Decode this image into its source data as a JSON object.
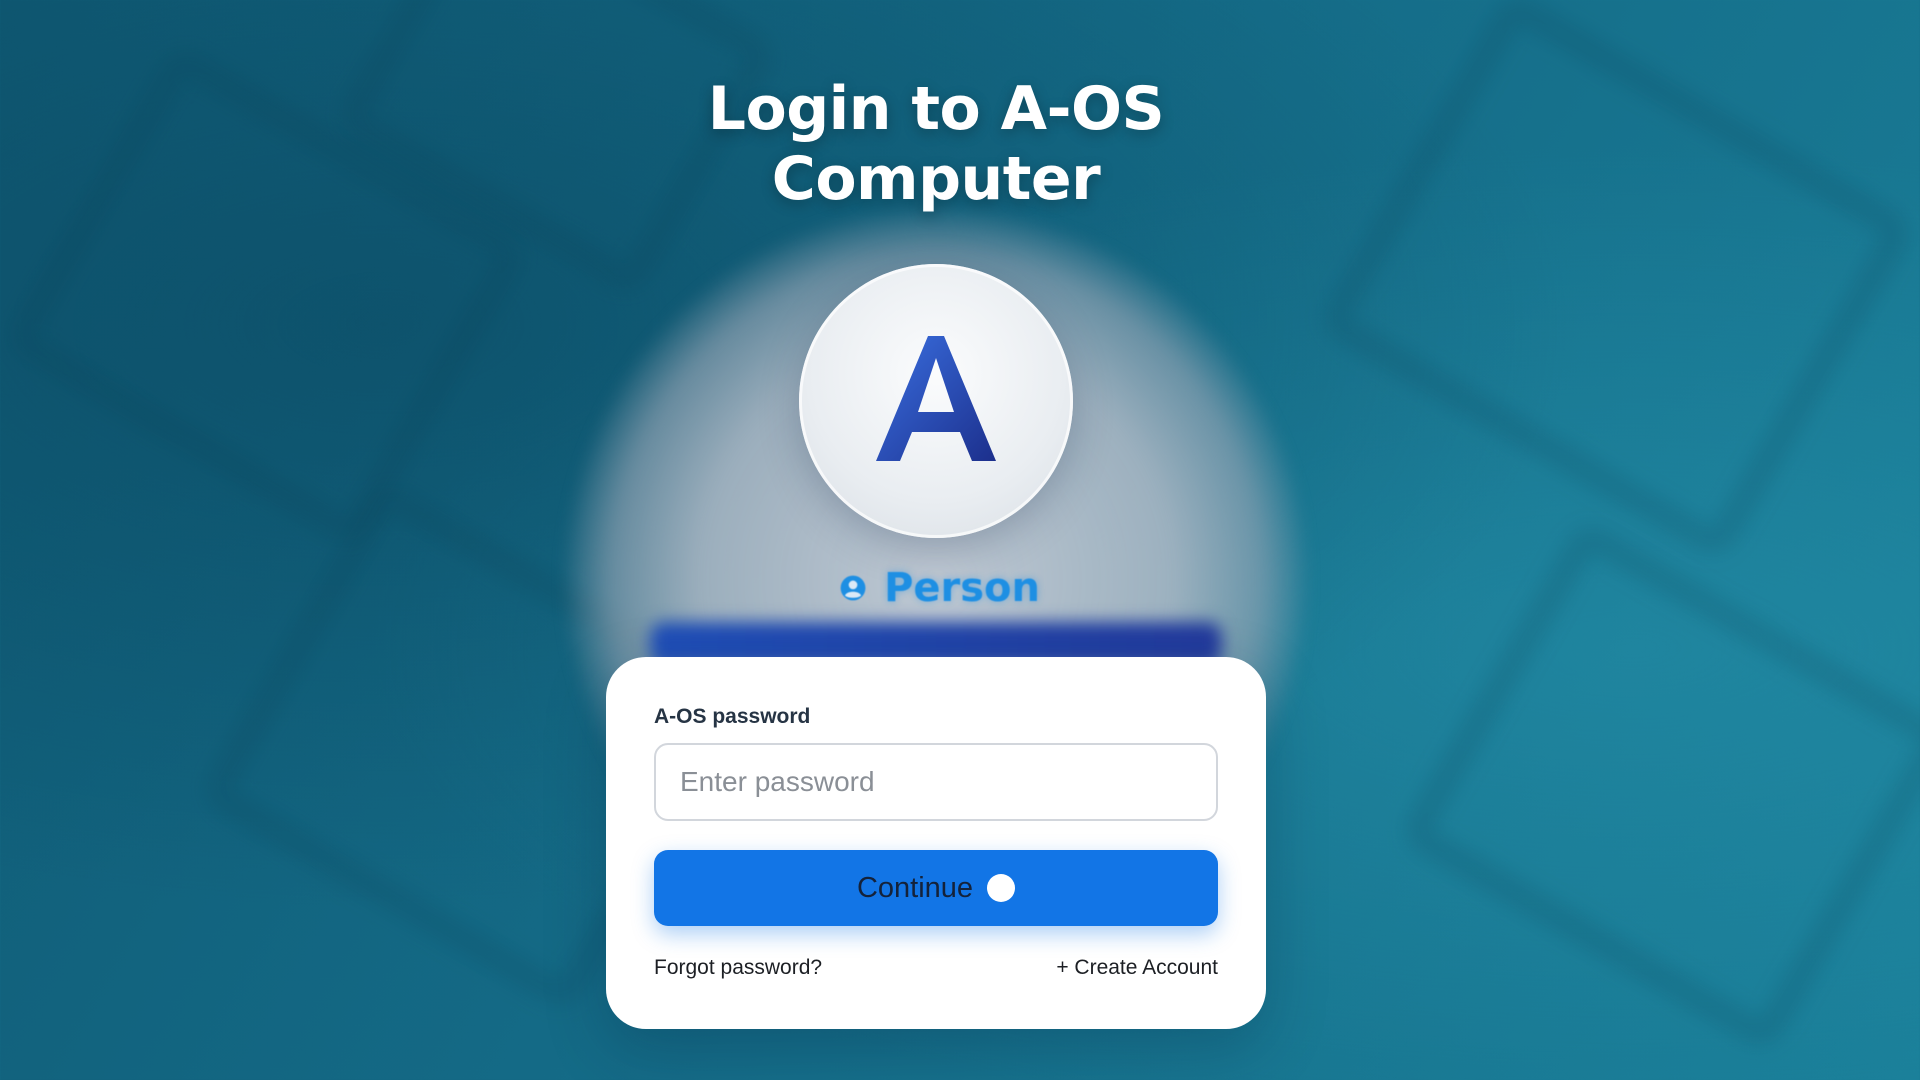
{
  "header": {
    "title_line1": "Login to A-OS",
    "title_line2": "Computer"
  },
  "logo": {
    "icon": "a-logo-icon",
    "colors": {
      "light": "#3a6fe0",
      "dark": "#1c2f8c"
    }
  },
  "user": {
    "icon": "user-circle-icon",
    "name": "Person",
    "color": "#1e8fe3"
  },
  "form": {
    "password_label": "A-OS password",
    "password_placeholder": "Enter password",
    "password_value": "",
    "continue_label": "Continue",
    "continue_color": "#1275e6",
    "forgot_label": "Forgot password?",
    "create_label": "+ Create Account"
  }
}
